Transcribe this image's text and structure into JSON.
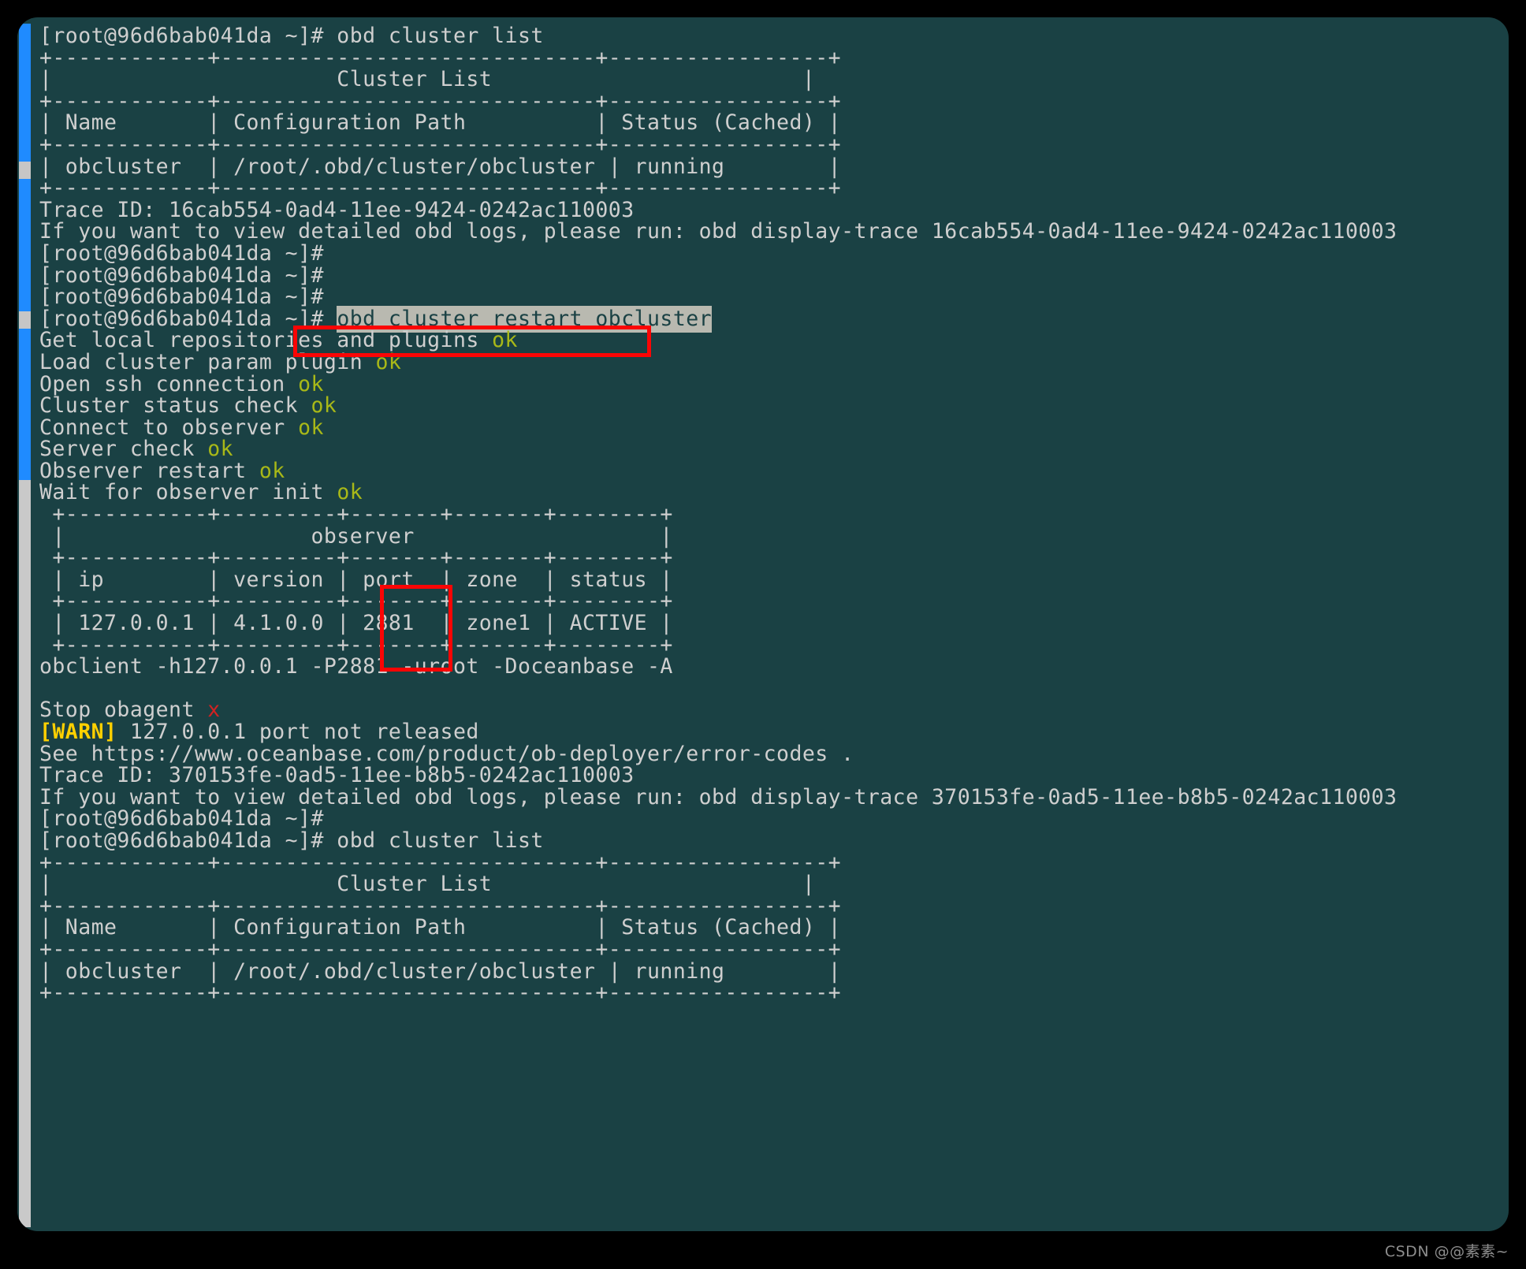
{
  "theme": {
    "terminal_bg": "#1a4144",
    "page_bg": "#000000",
    "text_fg": "#cfcfcf",
    "ok_color": "#a8b818",
    "error_color": "#d22222",
    "warn_color": "#ffd000",
    "selection_bg": "#b9b9b0",
    "selection_fg": "#1a4144",
    "annotation_color": "#fb0505",
    "scrollbar_blue": "#1f8bff",
    "scrollbar_grey": "#c9c9c9"
  },
  "prompt": "[root@96d6bab041da ~]#",
  "annotations": {
    "command_highlight": "obd cluster restart obcluster",
    "zone_column_highlight": "zone"
  },
  "watermark": "CSDN @@素素~",
  "lines": [
    {
      "id": "l01",
      "text": "[root@96d6bab041da ~]# obd cluster list"
    },
    {
      "id": "l02",
      "text": "+------------+-----------------------------+-----------------+"
    },
    {
      "id": "l03",
      "text": "|                      Cluster List                        |"
    },
    {
      "id": "l04",
      "text": "+------------+-----------------------------+-----------------+"
    },
    {
      "id": "l05",
      "text": "| Name       | Configuration Path          | Status (Cached) |"
    },
    {
      "id": "l06",
      "text": "+------------+-----------------------------+-----------------+"
    },
    {
      "id": "l07",
      "text": "| obcluster  | /root/.obd/cluster/obcluster | running        |"
    },
    {
      "id": "l08",
      "text": "+------------+-----------------------------+-----------------+"
    },
    {
      "id": "l09",
      "text": "Trace ID: 16cab554-0ad4-11ee-9424-0242ac110003"
    },
    {
      "id": "l10",
      "text": "If you want to view detailed obd logs, please run: obd display-trace 16cab554-0ad4-11ee-9424-0242ac110003"
    },
    {
      "id": "l11",
      "text": "[root@96d6bab041da ~]#"
    },
    {
      "id": "l12",
      "text": "[root@96d6bab041da ~]#"
    },
    {
      "id": "l13",
      "text": "[root@96d6bab041da ~]#"
    },
    {
      "id": "l14",
      "prompt": "[root@96d6bab041da ~]# ",
      "selected": "obd cluster restart obcluster"
    },
    {
      "id": "l15",
      "text": "Get local repositories and plugins ",
      "status": "ok",
      "status_kind": "ok"
    },
    {
      "id": "l16",
      "text": "Load cluster param plugin ",
      "status": "ok",
      "status_kind": "ok"
    },
    {
      "id": "l17",
      "text": "Open ssh connection ",
      "status": "ok",
      "status_kind": "ok"
    },
    {
      "id": "l18",
      "text": "Cluster status check ",
      "status": "ok",
      "status_kind": "ok"
    },
    {
      "id": "l19",
      "text": "Connect to observer ",
      "status": "ok",
      "status_kind": "ok"
    },
    {
      "id": "l20",
      "text": "Server check ",
      "status": "ok",
      "status_kind": "ok"
    },
    {
      "id": "l21",
      "text": "Observer restart ",
      "status": "ok",
      "status_kind": "ok"
    },
    {
      "id": "l22",
      "text": "Wait for observer init ",
      "status": "ok",
      "status_kind": "ok"
    },
    {
      "id": "l23",
      "text": " +-----------+---------+-------+-------+--------+"
    },
    {
      "id": "l24",
      "text": " |                   observer                   |"
    },
    {
      "id": "l25",
      "text": " +-----------+---------+-------+-------+--------+"
    },
    {
      "id": "l26",
      "text": " | ip        | version | port  | zone  | status |"
    },
    {
      "id": "l27",
      "text": " +-----------+---------+-------+-------+--------+"
    },
    {
      "id": "l28",
      "text": " | 127.0.0.1 | 4.1.0.0 | 2881  | zone1 | ACTIVE |"
    },
    {
      "id": "l29",
      "text": " +-----------+---------+-------+-------+--------+"
    },
    {
      "id": "l30",
      "text": "obclient -h127.0.0.1 -P2881 -uroot -Doceanbase -A"
    },
    {
      "id": "l31",
      "text": ""
    },
    {
      "id": "l32",
      "text": "Stop obagent ",
      "status": "x",
      "status_kind": "err"
    },
    {
      "id": "l33",
      "warn": "[WARN]",
      "text": " 127.0.0.1 port not released"
    },
    {
      "id": "l34",
      "text": "See https://www.oceanbase.com/product/ob-deployer/error-codes ."
    },
    {
      "id": "l35",
      "text": "Trace ID: 370153fe-0ad5-11ee-b8b5-0242ac110003"
    },
    {
      "id": "l36",
      "text": "If you want to view detailed obd logs, please run: obd display-trace 370153fe-0ad5-11ee-b8b5-0242ac110003"
    },
    {
      "id": "l37",
      "text": "[root@96d6bab041da ~]#"
    },
    {
      "id": "l38",
      "text": "[root@96d6bab041da ~]# obd cluster list"
    },
    {
      "id": "l39",
      "text": "+------------+-----------------------------+-----------------+"
    },
    {
      "id": "l40",
      "text": "|                      Cluster List                        |"
    },
    {
      "id": "l41",
      "text": "+------------+-----------------------------+-----------------+"
    },
    {
      "id": "l42",
      "text": "| Name       | Configuration Path          | Status (Cached) |"
    },
    {
      "id": "l43",
      "text": "+------------+-----------------------------+-----------------+"
    },
    {
      "id": "l44",
      "text": "| obcluster  | /root/.obd/cluster/obcluster | running        |"
    },
    {
      "id": "l45",
      "text": "+------------+-----------------------------+-----------------+"
    }
  ],
  "cluster_list_table": {
    "title": "Cluster List",
    "columns": [
      "Name",
      "Configuration Path",
      "Status (Cached)"
    ],
    "rows": [
      [
        "obcluster",
        "/root/.obd/cluster/obcluster",
        "running"
      ]
    ]
  },
  "observer_table": {
    "title": "observer",
    "columns": [
      "ip",
      "version",
      "port",
      "zone",
      "status"
    ],
    "rows": [
      [
        "127.0.0.1",
        "4.1.0.0",
        "2881",
        "zone1",
        "ACTIVE"
      ]
    ]
  }
}
